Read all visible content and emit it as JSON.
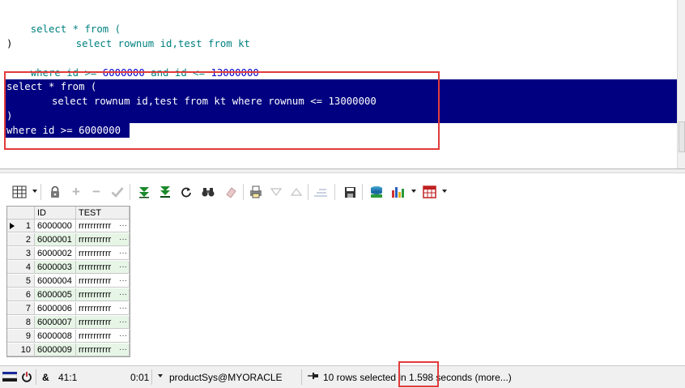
{
  "editor": {
    "query1": {
      "l1": {
        "a": "select * from ("
      },
      "l2": {
        "a": "select rownum id,test from kt"
      },
      "l3": {
        "a": ")"
      },
      "l4": {
        "a": "where id >= ",
        "b": "6000000",
        "c": " and ",
        "d": "id <= ",
        "e": "13000000"
      }
    },
    "query2": {
      "l1": "select * from (",
      "l2": "select rownum id,test from kt where rownum <= 13000000",
      "l3": ")",
      "l4": "where id >= 6000000"
    }
  },
  "toolbar": {
    "icons": [
      "grid-icon",
      "lock-icon",
      "plus-icon",
      "minus-icon",
      "check-icon",
      "fetch-next-icon",
      "fetch-all-icon",
      "refresh-icon",
      "binoculars-icon",
      "eraser-icon",
      "print-icon",
      "triangle-down-icon",
      "triangle-up-icon",
      "wizard-icon",
      "save-icon",
      "export-icon",
      "chart-icon",
      "table-icon"
    ]
  },
  "grid": {
    "columns": [
      "ID",
      "TEST"
    ],
    "rows": [
      {
        "n": "1",
        "id": "6000000",
        "test": "rrrrrrrrrrr"
      },
      {
        "n": "2",
        "id": "6000001",
        "test": "rrrrrrrrrrr"
      },
      {
        "n": "3",
        "id": "6000002",
        "test": "rrrrrrrrrrr"
      },
      {
        "n": "4",
        "id": "6000003",
        "test": "rrrrrrrrrrr"
      },
      {
        "n": "5",
        "id": "6000004",
        "test": "rrrrrrrrrrr"
      },
      {
        "n": "6",
        "id": "6000005",
        "test": "rrrrrrrrrrr"
      },
      {
        "n": "7",
        "id": "6000006",
        "test": "rrrrrrrrrrr"
      },
      {
        "n": "8",
        "id": "6000007",
        "test": "rrrrrrrrrrr"
      },
      {
        "n": "9",
        "id": "6000008",
        "test": "rrrrrrrrrrr"
      },
      {
        "n": "10",
        "id": "6000009",
        "test": "rrrrrrrrrrr"
      }
    ]
  },
  "status": {
    "cursor": "41:1",
    "amp": "&",
    "elapsed": "0:01",
    "connection": "productSys@MYORACLE",
    "message": "10 rows selected in 1.598 seconds (more...)"
  }
}
